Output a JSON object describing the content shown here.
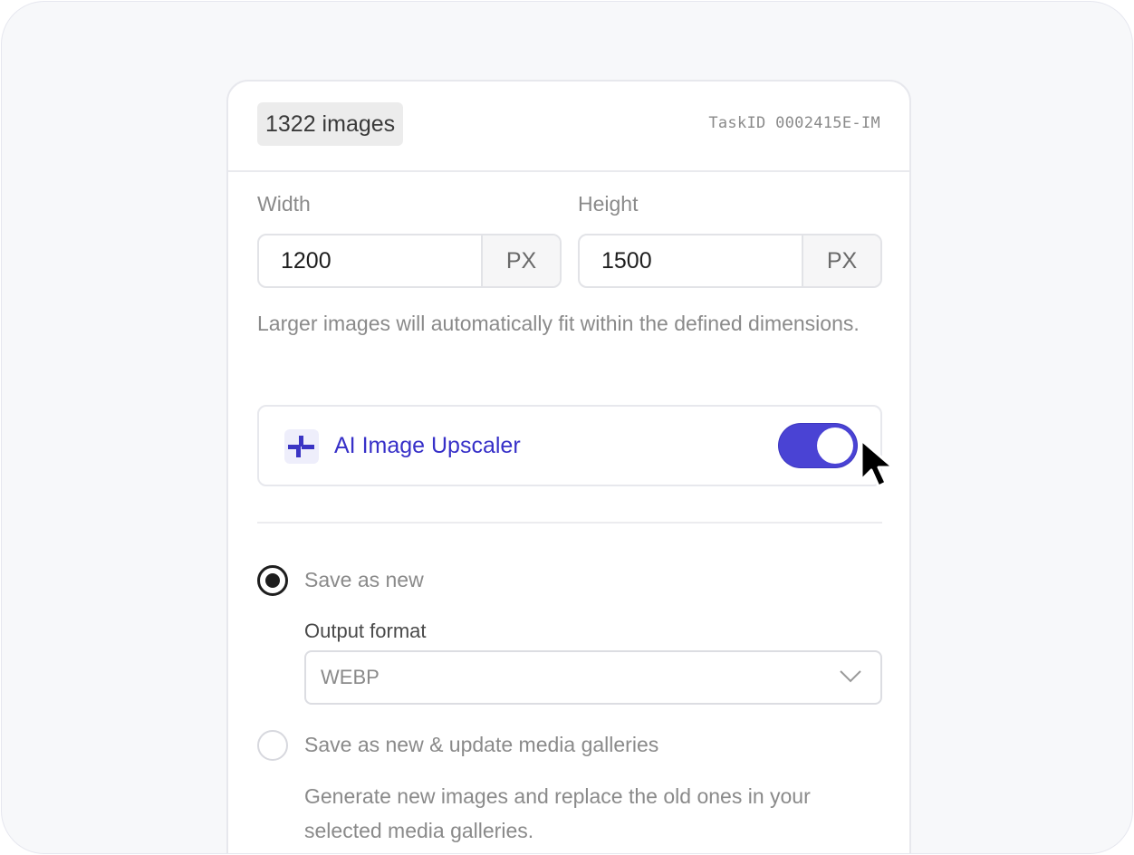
{
  "header": {
    "image_count": "1322 images",
    "task_id": "TaskID 0002415E-IM"
  },
  "dimensions": {
    "width": {
      "label": "Width",
      "value": "1200",
      "unit": "PX"
    },
    "height": {
      "label": "Height",
      "value": "1500",
      "unit": "PX"
    },
    "hint": "Larger images will automatically fit within the defined dimensions."
  },
  "upscaler": {
    "label": "AI Image Upscaler",
    "enabled": true,
    "icon": "sparkle-icon",
    "accent_color": "#4a43d4"
  },
  "save_options": {
    "save_as_new": {
      "label": "Save as new",
      "selected": true,
      "output_format_label": "Output format",
      "output_format_value": "WEBP"
    },
    "save_and_update": {
      "label": "Save as new & update media galleries",
      "selected": false,
      "description": "Generate new images and replace the old ones in your selected media galleries."
    }
  }
}
